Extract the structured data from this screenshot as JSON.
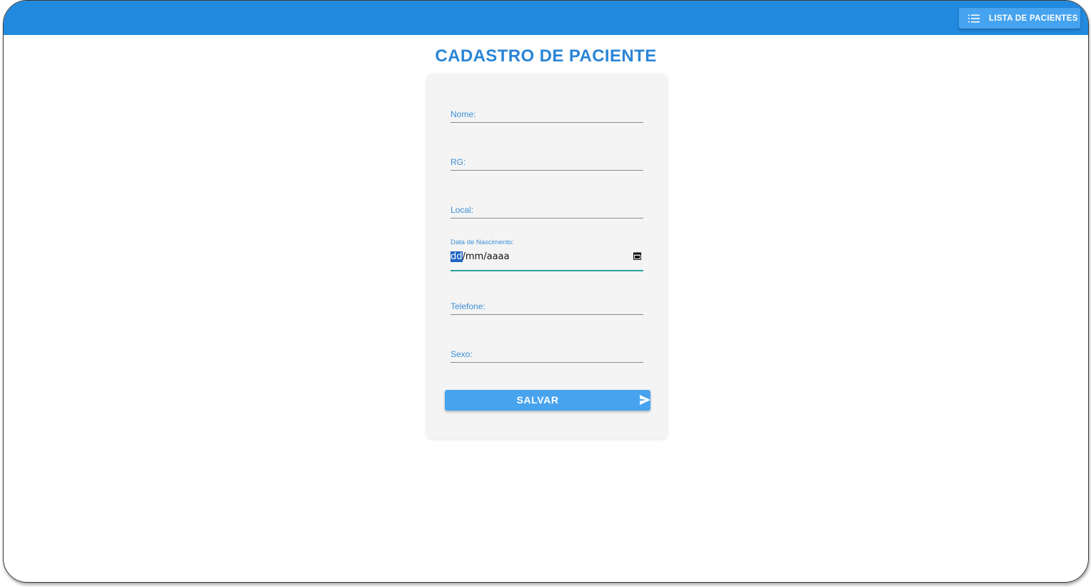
{
  "header": {
    "list_button": {
      "label": "LISTA DE PACIENTES",
      "icon": "list-icon"
    },
    "color": "#2189de"
  },
  "page": {
    "title": "CADASTRO DE PACIENTE"
  },
  "form": {
    "fields": [
      {
        "label": "Nome:",
        "value": ""
      },
      {
        "label": "RG:",
        "value": ""
      },
      {
        "label": "Local:",
        "value": ""
      },
      {
        "label": "Data de Nascimento:",
        "value_day": "dd",
        "value_rest": "/mm/aaaa",
        "icon": "calendar-icon"
      },
      {
        "label": "Telefone:",
        "value": ""
      },
      {
        "label": "Sexo:",
        "value": ""
      }
    ],
    "submit": {
      "label": "SALVAR",
      "icon": "send-icon"
    }
  },
  "colors": {
    "accent": "#2a85d7",
    "button": "#47a3ee",
    "focus_underline": "#2aa29a"
  }
}
